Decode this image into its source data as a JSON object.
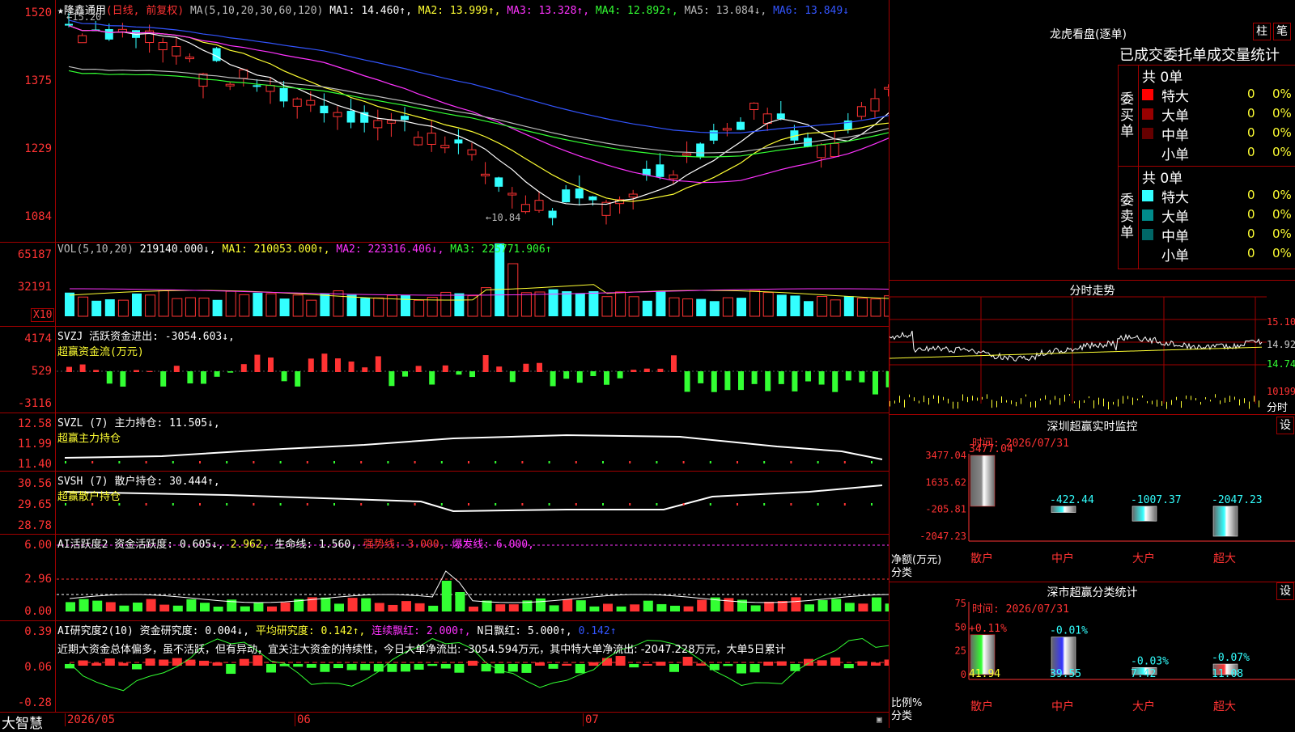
{
  "main": {
    "star": "★",
    "stock_name": "隆鑫通用",
    "period_label": "(日线, 前复权)",
    "ma_params": "MA(5,10,20,30,60,120)",
    "ma1": "MA1: 14.460↑,",
    "ma2": "MA2: 13.999↑,",
    "ma3": "MA3: 13.328↑,",
    "ma4": "MA4: 12.892↑,",
    "ma5": "MA5: 13.084↓,",
    "ma6": "MA6: 13.849↓",
    "y_labels": [
      "1520",
      "1375",
      "1229",
      "1084"
    ],
    "high_marker": "←15.20",
    "low_marker": "←10.84",
    "colors": {
      "ma1": "#ffffff",
      "ma2": "#ffff33",
      "ma3": "#ff33ff",
      "ma4": "#33ff33",
      "ma5": "#bbbbbb",
      "ma6": "#3355ff",
      "up": "#ff3333",
      "down": "#33ffff"
    }
  },
  "vol": {
    "title": "VOL(5,10,20)",
    "value": "219140.000↓,",
    "ma1": "MA1: 210053.000↑,",
    "ma2": "MA2: 223316.406↓,",
    "ma3": "MA3: 225771.906↑",
    "y_labels": [
      "65187",
      "32191"
    ],
    "unit": "X10"
  },
  "svzj": {
    "title": "SVZJ  活跃资金进出: -3054.603↓,",
    "subtitle": "超赢资金流(万元)",
    "y_labels": [
      "4174",
      "529",
      "-3116"
    ]
  },
  "svzl": {
    "title": "SVZL (7) 主力持仓: 11.505↓,",
    "subtitle": "超赢主力持仓",
    "y_labels": [
      "12.58",
      "11.99",
      "11.40"
    ]
  },
  "svsh": {
    "title": "SVSH (7) 散户持仓: 30.444↑,",
    "subtitle": "超赢散户持仓",
    "y_labels": [
      "30.56",
      "29.65",
      "28.78"
    ]
  },
  "ai_active": {
    "title": "AI活跃度2 资金活跃度: 0.605↓,",
    "v2": "2.962,",
    "life_line": "生命线: 1.560,",
    "strong_line": "强势线: 3.000,",
    "burst_line": "爆发线: 6.000,",
    "y_labels": [
      "6.00",
      "2.96",
      "0.00"
    ]
  },
  "ai_research": {
    "title": "AI研究度2(10) 资金研究度: 0.004↓,",
    "avg": "平均研究度: 0.142↑,",
    "streak": "连续飘红: 2.000↑,",
    "nday": "N日飘红: 5.000↑,",
    "last": "0.142↑",
    "comment": "近期大资金总体偏多，虽不活跃，但有异动，宜关注大资金的持续性，今日大单净流出: -3054.594万元，其中特大单净流出: -2047.228万元，大单5日累计",
    "y_labels": [
      "0.39",
      "0.06",
      "-0.28"
    ]
  },
  "footer": {
    "brand": "大智慧",
    "dates": [
      "2026/05",
      "06",
      "07"
    ]
  },
  "longhu": {
    "title": "龙虎看盘(逐单)",
    "btn_bar": "柱",
    "btn_pen": "笔",
    "tabs": "已成交委托单成交量统计",
    "buy_label": "委买单",
    "sell_label": "委卖单",
    "buy_total": "共 0单",
    "sell_total": "共 0单",
    "buy_rows": [
      {
        "name": "特大",
        "count": "0",
        "pct": "0%",
        "color": "#ff0000"
      },
      {
        "name": "大单",
        "count": "0",
        "pct": "0%",
        "color": "#990000"
      },
      {
        "name": "中单",
        "count": "0",
        "pct": "0%",
        "color": "#660000"
      },
      {
        "name": "小单",
        "count": "0",
        "pct": "0%",
        "color": "#000000"
      }
    ],
    "sell_rows": [
      {
        "name": "特大",
        "count": "0",
        "pct": "0%",
        "color": "#33ffff"
      },
      {
        "name": "大单",
        "count": "0",
        "pct": "0%",
        "color": "#008b8b"
      },
      {
        "name": "中单",
        "count": "0",
        "pct": "0%",
        "color": "#006666"
      },
      {
        "name": "小单",
        "count": "0",
        "pct": "0%",
        "color": "#000000"
      }
    ]
  },
  "intraday": {
    "title": "分时走势",
    "y_labels": [
      "15.10",
      "14.92",
      "14.74",
      "10199"
    ],
    "vol_label": "分时"
  },
  "sz_monitor": {
    "title": "深圳超赢实时监控",
    "btn": "设",
    "time": "时间: 2026/07/31",
    "y_labels": [
      "3477.04",
      "1635.62",
      "-205.81",
      "-2047.23"
    ],
    "ylabel_top": "净额(万元)",
    "ylabel_bottom": "分类",
    "chart_data": {
      "type": "bar",
      "categories": [
        "散户",
        "中户",
        "大户",
        "超大"
      ],
      "values": [
        3477.04,
        -422.44,
        -1007.37,
        -2047.23
      ],
      "labels": [
        "3477.04",
        "-422.44",
        "-1007.37",
        "-2047.23"
      ],
      "ylim": [
        -2047.23,
        3477.04
      ]
    }
  },
  "sz_stats": {
    "title": "深市超赢分类统计",
    "btn": "设",
    "time": "时间: 2026/07/31",
    "y_labels": [
      "75",
      "50",
      "25",
      "0"
    ],
    "ylabel_top": "比例%",
    "ylabel_bottom": "分类",
    "chart_data": {
      "type": "bar",
      "categories": [
        "散户",
        "中户",
        "大户",
        "超大"
      ],
      "values": [
        41.94,
        39.55,
        7.42,
        11.08
      ],
      "change_labels": [
        "+0.11%",
        "-0.01%",
        "-0.03%",
        "-0.07%"
      ],
      "value_labels": [
        "41.94",
        "39.55",
        "7.42",
        "11.08"
      ],
      "ylim": [
        0,
        75
      ]
    }
  }
}
